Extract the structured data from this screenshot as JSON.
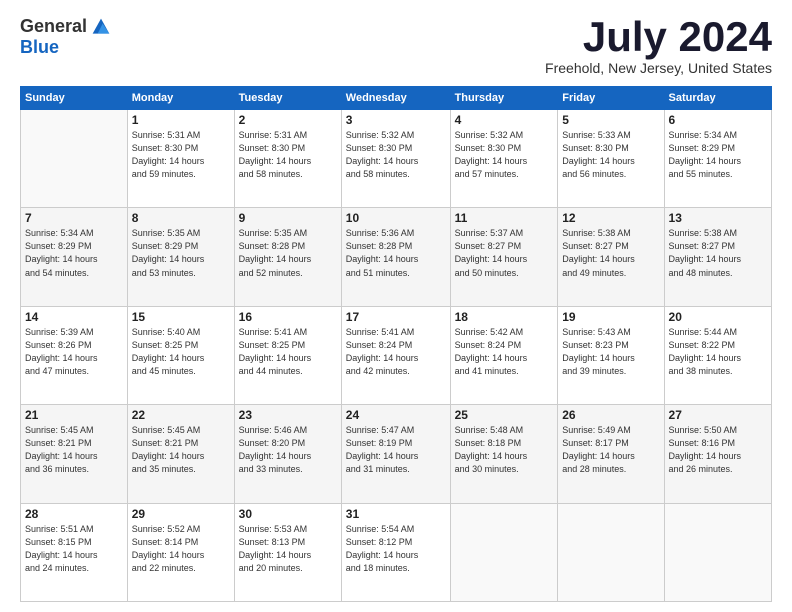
{
  "header": {
    "logo_general": "General",
    "logo_blue": "Blue",
    "title": "July 2024",
    "location": "Freehold, New Jersey, United States"
  },
  "weekdays": [
    "Sunday",
    "Monday",
    "Tuesday",
    "Wednesday",
    "Thursday",
    "Friday",
    "Saturday"
  ],
  "weeks": [
    [
      {
        "day": "",
        "info": ""
      },
      {
        "day": "1",
        "info": "Sunrise: 5:31 AM\nSunset: 8:30 PM\nDaylight: 14 hours\nand 59 minutes."
      },
      {
        "day": "2",
        "info": "Sunrise: 5:31 AM\nSunset: 8:30 PM\nDaylight: 14 hours\nand 58 minutes."
      },
      {
        "day": "3",
        "info": "Sunrise: 5:32 AM\nSunset: 8:30 PM\nDaylight: 14 hours\nand 58 minutes."
      },
      {
        "day": "4",
        "info": "Sunrise: 5:32 AM\nSunset: 8:30 PM\nDaylight: 14 hours\nand 57 minutes."
      },
      {
        "day": "5",
        "info": "Sunrise: 5:33 AM\nSunset: 8:30 PM\nDaylight: 14 hours\nand 56 minutes."
      },
      {
        "day": "6",
        "info": "Sunrise: 5:34 AM\nSunset: 8:29 PM\nDaylight: 14 hours\nand 55 minutes."
      }
    ],
    [
      {
        "day": "7",
        "info": "Sunrise: 5:34 AM\nSunset: 8:29 PM\nDaylight: 14 hours\nand 54 minutes."
      },
      {
        "day": "8",
        "info": "Sunrise: 5:35 AM\nSunset: 8:29 PM\nDaylight: 14 hours\nand 53 minutes."
      },
      {
        "day": "9",
        "info": "Sunrise: 5:35 AM\nSunset: 8:28 PM\nDaylight: 14 hours\nand 52 minutes."
      },
      {
        "day": "10",
        "info": "Sunrise: 5:36 AM\nSunset: 8:28 PM\nDaylight: 14 hours\nand 51 minutes."
      },
      {
        "day": "11",
        "info": "Sunrise: 5:37 AM\nSunset: 8:27 PM\nDaylight: 14 hours\nand 50 minutes."
      },
      {
        "day": "12",
        "info": "Sunrise: 5:38 AM\nSunset: 8:27 PM\nDaylight: 14 hours\nand 49 minutes."
      },
      {
        "day": "13",
        "info": "Sunrise: 5:38 AM\nSunset: 8:27 PM\nDaylight: 14 hours\nand 48 minutes."
      }
    ],
    [
      {
        "day": "14",
        "info": "Sunrise: 5:39 AM\nSunset: 8:26 PM\nDaylight: 14 hours\nand 47 minutes."
      },
      {
        "day": "15",
        "info": "Sunrise: 5:40 AM\nSunset: 8:25 PM\nDaylight: 14 hours\nand 45 minutes."
      },
      {
        "day": "16",
        "info": "Sunrise: 5:41 AM\nSunset: 8:25 PM\nDaylight: 14 hours\nand 44 minutes."
      },
      {
        "day": "17",
        "info": "Sunrise: 5:41 AM\nSunset: 8:24 PM\nDaylight: 14 hours\nand 42 minutes."
      },
      {
        "day": "18",
        "info": "Sunrise: 5:42 AM\nSunset: 8:24 PM\nDaylight: 14 hours\nand 41 minutes."
      },
      {
        "day": "19",
        "info": "Sunrise: 5:43 AM\nSunset: 8:23 PM\nDaylight: 14 hours\nand 39 minutes."
      },
      {
        "day": "20",
        "info": "Sunrise: 5:44 AM\nSunset: 8:22 PM\nDaylight: 14 hours\nand 38 minutes."
      }
    ],
    [
      {
        "day": "21",
        "info": "Sunrise: 5:45 AM\nSunset: 8:21 PM\nDaylight: 14 hours\nand 36 minutes."
      },
      {
        "day": "22",
        "info": "Sunrise: 5:45 AM\nSunset: 8:21 PM\nDaylight: 14 hours\nand 35 minutes."
      },
      {
        "day": "23",
        "info": "Sunrise: 5:46 AM\nSunset: 8:20 PM\nDaylight: 14 hours\nand 33 minutes."
      },
      {
        "day": "24",
        "info": "Sunrise: 5:47 AM\nSunset: 8:19 PM\nDaylight: 14 hours\nand 31 minutes."
      },
      {
        "day": "25",
        "info": "Sunrise: 5:48 AM\nSunset: 8:18 PM\nDaylight: 14 hours\nand 30 minutes."
      },
      {
        "day": "26",
        "info": "Sunrise: 5:49 AM\nSunset: 8:17 PM\nDaylight: 14 hours\nand 28 minutes."
      },
      {
        "day": "27",
        "info": "Sunrise: 5:50 AM\nSunset: 8:16 PM\nDaylight: 14 hours\nand 26 minutes."
      }
    ],
    [
      {
        "day": "28",
        "info": "Sunrise: 5:51 AM\nSunset: 8:15 PM\nDaylight: 14 hours\nand 24 minutes."
      },
      {
        "day": "29",
        "info": "Sunrise: 5:52 AM\nSunset: 8:14 PM\nDaylight: 14 hours\nand 22 minutes."
      },
      {
        "day": "30",
        "info": "Sunrise: 5:53 AM\nSunset: 8:13 PM\nDaylight: 14 hours\nand 20 minutes."
      },
      {
        "day": "31",
        "info": "Sunrise: 5:54 AM\nSunset: 8:12 PM\nDaylight: 14 hours\nand 18 minutes."
      },
      {
        "day": "",
        "info": ""
      },
      {
        "day": "",
        "info": ""
      },
      {
        "day": "",
        "info": ""
      }
    ]
  ]
}
